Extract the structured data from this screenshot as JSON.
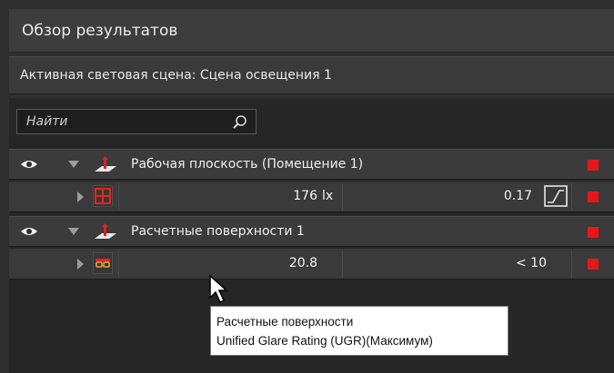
{
  "title_bar": {
    "title": "Обзор результатов"
  },
  "scene": {
    "label": "Активная световая сцена: Сцена освещения 1"
  },
  "search": {
    "placeholder": "Найти",
    "icon": "search-icon"
  },
  "groups": [
    {
      "label": "Рабочая плоскость (Помещение 1)",
      "item": {
        "value": "176",
        "unit": "lx",
        "secondary": "0.17",
        "icon": "grid-icon",
        "status_color": "#e8151b"
      },
      "status_color": "#e8151b"
    },
    {
      "label": "Расчетные поверхности 1",
      "item": {
        "value": "20.8",
        "unit": "",
        "secondary": "< 10",
        "icon": "glare-icon",
        "status_color": "#e8151b"
      },
      "status_color": "#e8151b"
    }
  ],
  "tooltip": {
    "line1": "Расчетные поверхности",
    "line2": "Unified Glare Rating (UGR)(Максимум)"
  }
}
